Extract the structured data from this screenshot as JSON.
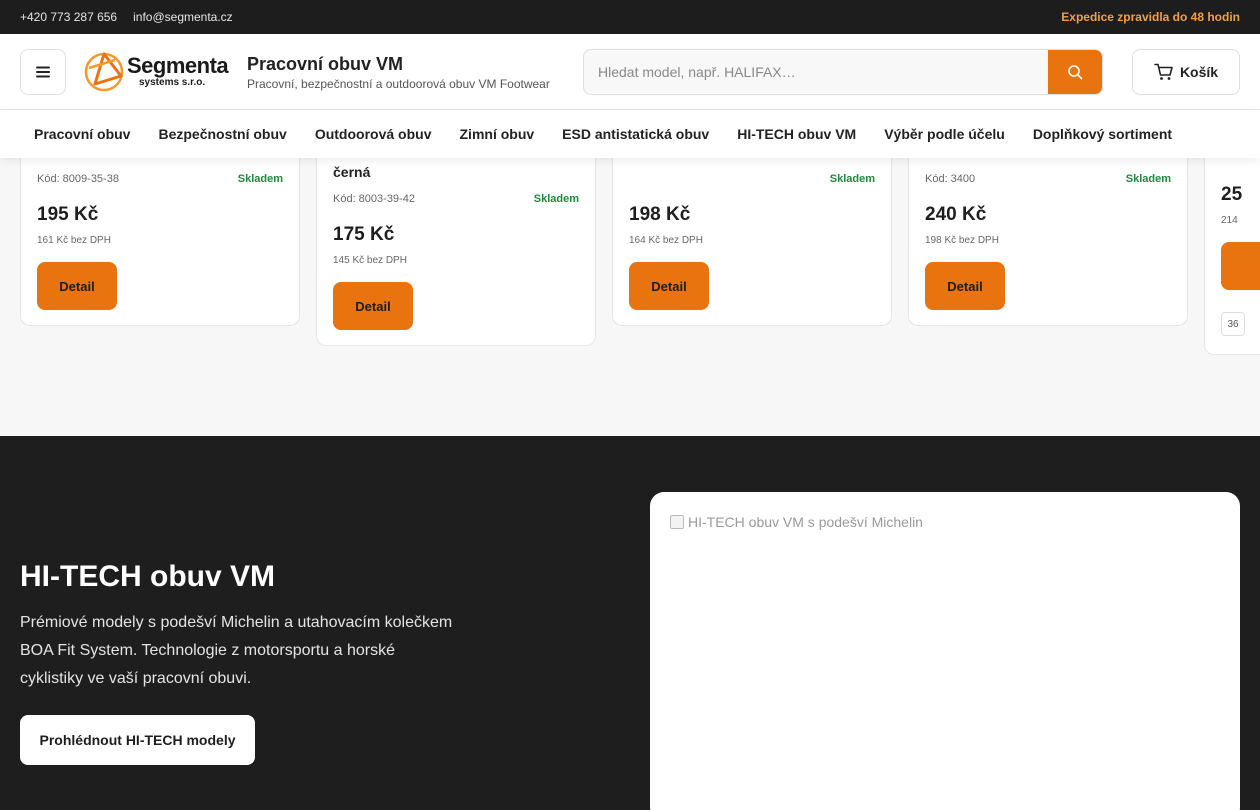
{
  "topbar": {
    "phone": "+420 773 287 656",
    "email": "info@segmenta.cz",
    "shipping": "Expedice zpravidla do 48 hodin"
  },
  "header": {
    "logo_word": "Segmenta",
    "logo_sub": "systems s.r.o.",
    "title": "Pracovní obuv VM",
    "subtitle": "Pracovní, bezpečnostní a outdoorová obuv VM Footwear",
    "search_placeholder": "Hledat model, např. HALIFAX…",
    "cart_label": "Košík"
  },
  "nav": [
    "Pracovní obuv",
    "Bezpečnostní obuv",
    "Outdoorová obuv",
    "Zimní obuv",
    "ESD antistatická obuv",
    "HI-TECH obuv VM",
    "Výběr podle účelu",
    "Doplňkový sortiment"
  ],
  "products": [
    {
      "name": "",
      "code": "Kód: 8009-35-38",
      "stock": "Skladem",
      "price": "195 Kč",
      "net": "161 Kč bez DPH",
      "detail": "Detail"
    },
    {
      "name": "černá",
      "code": "Kód: 8003-39-42",
      "stock": "Skladem",
      "price": "175 Kč",
      "net": "145 Kč bez DPH",
      "detail": "Detail"
    },
    {
      "name": "",
      "code": "",
      "stock": "Skladem",
      "price": "198 Kč",
      "net": "164 Kč bez DPH",
      "detail": "Detail"
    },
    {
      "name": "",
      "code": "Kód: 3400",
      "stock": "Skladem",
      "price": "240 Kč",
      "net": "198 Kč bez DPH",
      "detail": "Detail"
    },
    {
      "name": "",
      "code": "",
      "stock": "",
      "price": "25",
      "net": "214",
      "detail": "",
      "size": "36"
    }
  ],
  "hero": {
    "title": "HI-TECH obuv VM",
    "text": "Prémiové modely s podešví Michelin a utahovacím kolečkem BOA Fit System. Technologie z motorsportu a horské cyklistiky ve vaší pracovní obuvi.",
    "button": "Prohlédnout HI-TECH modely",
    "image_alt": "HI-TECH obuv VM s podešví Michelin"
  },
  "colors": {
    "accent": "#e8730f",
    "dark": "#1e1e1e",
    "stock": "#1f8a3b",
    "shipping": "#f0a04b"
  }
}
